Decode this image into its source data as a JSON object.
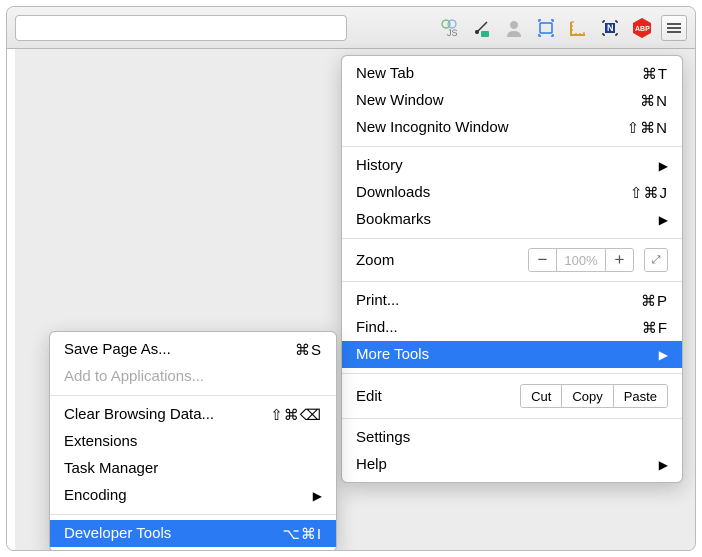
{
  "mainMenu": {
    "newTab": "New Tab",
    "newTabSc": "⌘T",
    "newWindow": "New Window",
    "newWindowSc": "⌘N",
    "newIncognito": "New Incognito Window",
    "newIncognitoSc": "⇧⌘N",
    "history": "History",
    "downloads": "Downloads",
    "downloadsSc": "⇧⌘J",
    "bookmarks": "Bookmarks",
    "zoom": "Zoom",
    "zoomPct": "100%",
    "print": "Print...",
    "printSc": "⌘P",
    "find": "Find...",
    "findSc": "⌘F",
    "moreTools": "More Tools",
    "edit": "Edit",
    "cut": "Cut",
    "copy": "Copy",
    "paste": "Paste",
    "settings": "Settings",
    "help": "Help"
  },
  "subMenu": {
    "savePage": "Save Page As...",
    "savePageSc": "⌘S",
    "addToApps": "Add to Applications...",
    "clearBrowsing": "Clear Browsing Data...",
    "clearBrowsingSc": "⇧⌘⌫",
    "extensions": "Extensions",
    "taskManager": "Task Manager",
    "encoding": "Encoding",
    "devTools": "Developer Tools",
    "devToolsSc": "⌥⌘I"
  }
}
